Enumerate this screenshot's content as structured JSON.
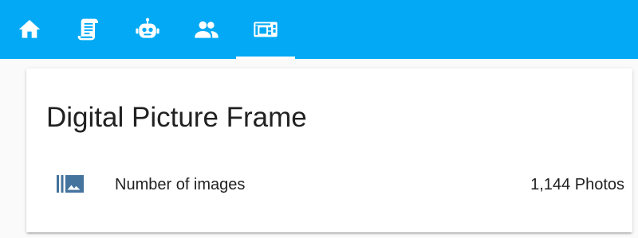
{
  "toolbar": {
    "background_color": "#03a9f4",
    "tabs": [
      {
        "icon": "home-icon",
        "active": false
      },
      {
        "icon": "script-icon",
        "active": false
      },
      {
        "icon": "robot-icon",
        "active": false
      },
      {
        "icon": "account-group-icon",
        "active": false
      },
      {
        "icon": "raspberry-pi-board-icon",
        "active": true
      }
    ]
  },
  "card": {
    "title": "Digital Picture Frame",
    "entities": [
      {
        "icon": "image-multiple-icon",
        "icon_color": "#44739e",
        "name": "Number of images",
        "state": "1,144 Photos"
      }
    ]
  }
}
